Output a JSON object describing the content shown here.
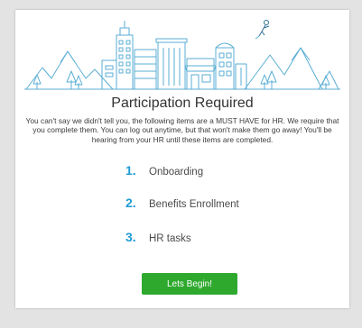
{
  "dialog": {
    "title": "Participation Required",
    "description": "You can't say we didn't tell you, the following items are a MUST HAVE for HR. We require that you complete them. You can log out anytime, but that won't make them go away! You'll be hearing from your HR until these items are completed.",
    "items": [
      {
        "number": "1.",
        "label": "Onboarding"
      },
      {
        "number": "2.",
        "label": "Benefits Enrollment"
      },
      {
        "number": "3.",
        "label": "HR tasks"
      }
    ],
    "begin_button": "Lets Begin!"
  },
  "colors": {
    "accent": "#1f9bd5",
    "button": "#2ea92e",
    "illustration_stroke": "#5aaed4",
    "background": "#e3e3e3"
  },
  "icons": [
    "city-skyline-illustration",
    "jetpack-person-icon"
  ]
}
